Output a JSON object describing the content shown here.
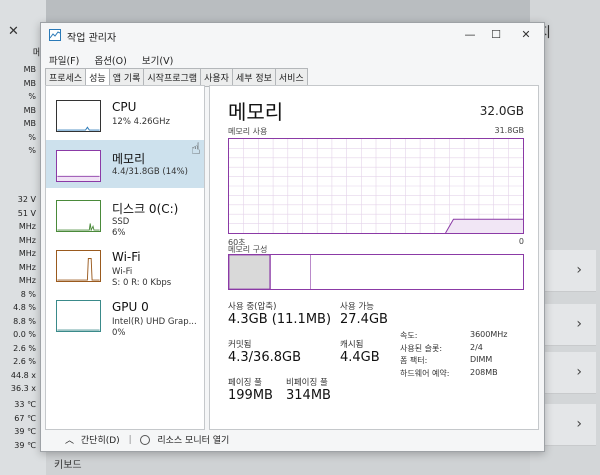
{
  "background_left": {
    "close_glyph": "✕",
    "header": "메",
    "col_a": [
      "MB",
      "MB",
      "%",
      "MB",
      "MB",
      "%",
      "%"
    ],
    "col_b": [
      "32 V",
      "51 V",
      "MHz",
      "MHz",
      "MHz",
      "MHz",
      "MHz",
      "8 %",
      "4.8 %",
      "8.8 %",
      "0.0 %",
      "2.6 %",
      "2.6 %",
      "44.8 x",
      "36.3 x"
    ],
    "col_c": [
      "33 ℃",
      "67 ℃",
      "39 ℃",
      "39 ℃"
    ]
  },
  "background_right": {
    "title_fragment": "지",
    "chevron": "›"
  },
  "background_bottom": {
    "text": "키보드"
  },
  "window": {
    "title": "작업 관리자",
    "controls": {
      "minimize": "—",
      "maximize": "☐",
      "close": "✕"
    }
  },
  "menu": [
    "파일(F)",
    "옵션(O)",
    "보기(V)"
  ],
  "tabs": [
    "프로세스",
    "성능",
    "앱 기록",
    "시작프로그램",
    "사용자",
    "세부 정보",
    "서비스"
  ],
  "active_tab": 1,
  "sidebar": {
    "items": [
      {
        "name": "CPU",
        "sub": "12% 4.26GHz",
        "sub2": ""
      },
      {
        "name": "메모리",
        "sub": "4.4/31.8GB (14%)",
        "sub2": ""
      },
      {
        "name": "디스크 0(C:)",
        "sub": "SSD",
        "sub2": "6%"
      },
      {
        "name": "Wi-Fi",
        "sub": "Wi-Fi",
        "sub2": "S: 0 R: 0 Kbps"
      },
      {
        "name": "GPU 0",
        "sub": "Intel(R) UHD Grap...",
        "sub2": "0%"
      }
    ],
    "selected": 1
  },
  "memory": {
    "title": "메모리",
    "total": "32.0GB",
    "usage_label": "메모리 사용",
    "usage_max": "31.8GB",
    "axis_left": "60초",
    "axis_right": "0",
    "composition_label": "메모리 구성",
    "in_use_fraction": 0.139,
    "stats": {
      "in_use_label": "사용 중(압축)",
      "in_use_value": "4.3GB (11.1MB)",
      "available_label": "사용 가능",
      "available_value": "27.4GB",
      "committed_label": "커밋됨",
      "committed_value": "4.3/36.8GB",
      "cached_label": "캐시됨",
      "cached_value": "4.4GB",
      "paged_label": "페이징 풀",
      "paged_value": "199MB",
      "nonpaged_label": "비페이징 풀",
      "nonpaged_value": "314MB"
    },
    "info": [
      {
        "k": "속도:",
        "v": "3600MHz"
      },
      {
        "k": "사용된 슬롯:",
        "v": "2/4"
      },
      {
        "k": "폼 팩터:",
        "v": "DIMM"
      },
      {
        "k": "하드웨어 예약:",
        "v": "208MB"
      }
    ]
  },
  "footer": {
    "summary": "간단히(D)",
    "resource_monitor": "리소스 모니터 열기"
  },
  "colors": {
    "memory_accent": "#8b3aa6",
    "selected_bg": "#cde1ed"
  }
}
